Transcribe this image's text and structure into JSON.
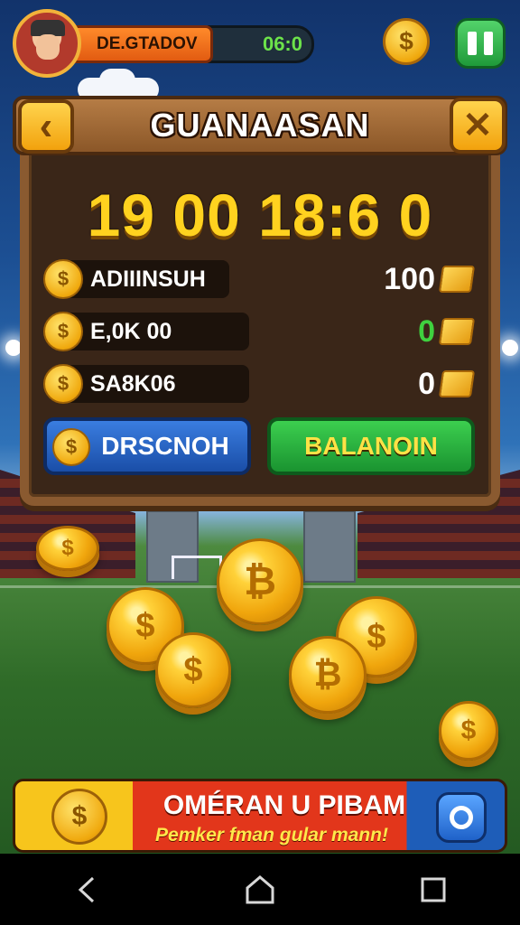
{
  "hud": {
    "player_name": "DE.GTADOV",
    "timer": "06:0",
    "coin_icon": "dollar-coin-icon",
    "pause_icon": "pause-icon"
  },
  "panel": {
    "title": "GUANAASAN",
    "score": "19 00 18:6 0",
    "rows": [
      {
        "label": "ADIIINSUH",
        "value": "100",
        "value_color": "#ffffff"
      },
      {
        "label": "E,0K 00",
        "value": "0",
        "value_color": "#3fd13f"
      },
      {
        "label": "SA8K06",
        "value": "0",
        "value_color": "#ffffff"
      }
    ],
    "blue_button": "DRSCNOH",
    "green_button": "BALANOIN"
  },
  "promo": {
    "title": "OMÉRAN U PIBAM",
    "subtitle": "Pemker fman gular mann!"
  },
  "glyphs": {
    "dollar": "$",
    "bitcoin": "₿",
    "back": "‹",
    "close": "✕"
  },
  "colors": {
    "accent_gold": "#ffd21f",
    "board_wood": "#8a5a30",
    "panel_dark": "#3a2618",
    "green_button": "#1a9330",
    "blue_button": "#1a4ea8"
  }
}
